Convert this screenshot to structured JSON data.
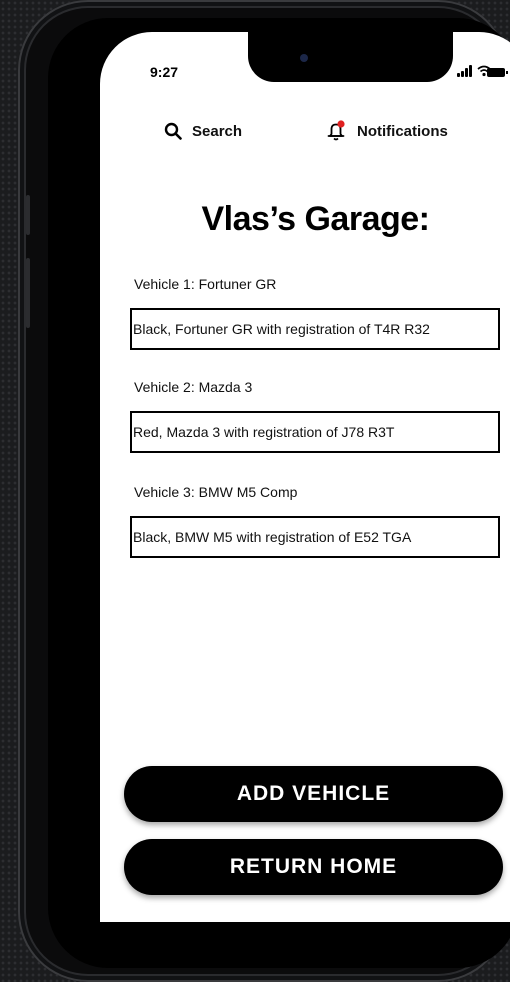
{
  "status_bar": {
    "time": "9:27"
  },
  "nav": {
    "search_label": "Search",
    "notifications_label": "Notifications"
  },
  "page": {
    "title": "Vlas’s Garage:"
  },
  "vehicles": [
    {
      "label": "Vehicle 1: Fortuner GR",
      "value": "Black, Fortuner GR with registration of T4R R32"
    },
    {
      "label": "Vehicle 2: Mazda 3",
      "value": "Red, Mazda 3 with registration of J78 R3T"
    },
    {
      "label": "Vehicle 3: BMW M5 Comp",
      "value": "Black, BMW M5 with registration of E52 TGA"
    }
  ],
  "actions": {
    "add_label": "ADD VEHICLE",
    "return_label": "RETURN HOME"
  },
  "colors": {
    "notification_dot": "#e02020",
    "button_bg": "#000000",
    "button_text": "#ffffff"
  },
  "icons": [
    "search-icon",
    "bell-icon",
    "signal-icon",
    "wifi-icon",
    "battery-icon"
  ]
}
